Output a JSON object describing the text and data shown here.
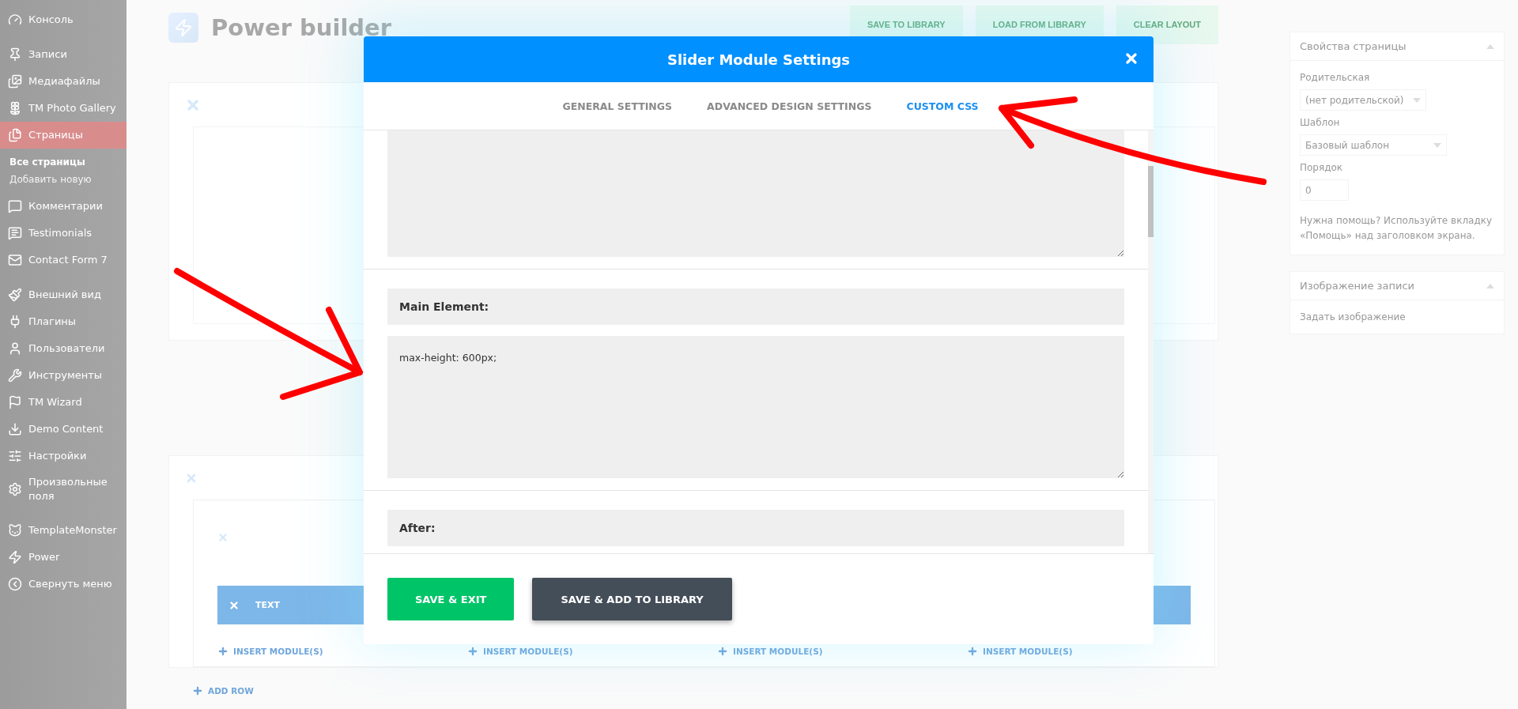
{
  "sidebar": {
    "groups": [
      [
        {
          "label": "Консоль",
          "selected": false
        }
      ],
      [
        {
          "label": "Записи",
          "selected": false
        },
        {
          "label": "Медиафайлы",
          "selected": false
        },
        {
          "label": "TM Photo Gallery",
          "selected": false
        },
        {
          "label": "Страницы",
          "selected": true,
          "children": [
            {
              "label": "Все страницы",
              "selected": true
            },
            {
              "label": "Добавить новую",
              "selected": false
            }
          ]
        },
        {
          "label": "Комментарии",
          "selected": false
        },
        {
          "label": "Testimonials",
          "selected": false
        },
        {
          "label": "Contact Form 7",
          "selected": false
        }
      ],
      [
        {
          "label": "Внешний вид",
          "selected": false
        },
        {
          "label": "Плагины",
          "selected": false
        },
        {
          "label": "Пользователи",
          "selected": false
        },
        {
          "label": "Инструменты",
          "selected": false
        },
        {
          "label": "TM Wizard",
          "selected": false
        },
        {
          "label": "Demo Content",
          "selected": false
        },
        {
          "label": "Настройки",
          "selected": false
        },
        {
          "label": "Произвольные поля",
          "selected": false
        }
      ],
      [
        {
          "label": "TemplateMonster",
          "selected": false
        },
        {
          "label": "Power",
          "selected": false
        },
        {
          "label": "Свернуть меню",
          "selected": false
        }
      ]
    ]
  },
  "builder": {
    "title": "Power builder",
    "buttons": [
      "SAVE TO LIBRARY",
      "LOAD FROM LIBRARY",
      "CLEAR LAYOUT"
    ],
    "module": "TEXT",
    "insert_buttons": [
      "INSERT MODULE(S)",
      "INSERT MODULE(S)",
      "INSERT MODULE(S)",
      "INSERT MODULE(S)"
    ],
    "add_row": "ADD ROW"
  },
  "right_panel": {
    "boxes": [
      {
        "title": "Свойства страницы",
        "expanded": true,
        "fields": [
          {
            "kind": "select",
            "label": "Родительская",
            "value": "(нет родительской)"
          },
          {
            "kind": "select",
            "label": "Шаблон",
            "value": "Базовый шаблон"
          },
          {
            "kind": "input",
            "label": "Порядок",
            "value": "0"
          }
        ],
        "help": "Нужна помощь? Используйте вкладку «Помощь» над заголовком экрана."
      },
      {
        "title": "Изображение записи",
        "expanded": true,
        "link": "Задать изображение"
      }
    ]
  },
  "modal": {
    "title": "Slider Module Settings",
    "tabs": [
      {
        "label": "GENERAL SETTINGS",
        "selected": false
      },
      {
        "label": "ADVANCED DESIGN SETTINGS",
        "selected": false
      },
      {
        "label": "CUSTOM CSS",
        "selected": true
      }
    ],
    "css_fields": [
      {
        "label": "Main Element:",
        "value": "max-height: 600px;"
      },
      {
        "label": "After:"
      }
    ],
    "buttons": [
      {
        "label": "SAVE & EXIT",
        "kind": "primary"
      },
      {
        "label": "SAVE & ADD TO LIBRARY",
        "kind": "secondary"
      }
    ]
  }
}
